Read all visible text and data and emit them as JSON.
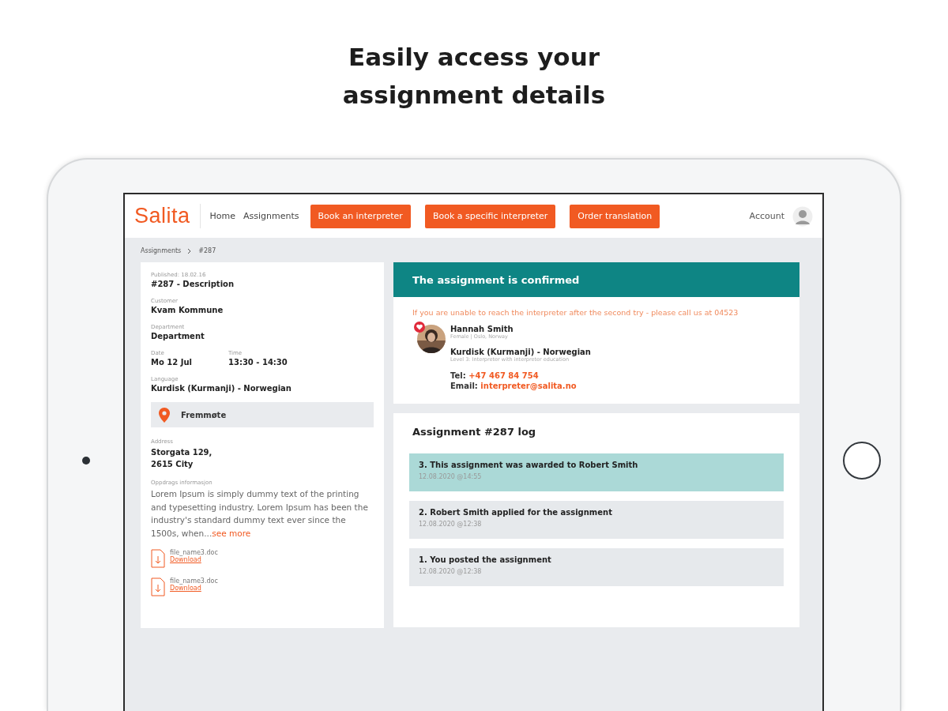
{
  "headline": "Easily access your assignment details",
  "header": {
    "logo": "Salita",
    "nav": [
      {
        "kind": "link",
        "label": "Home"
      },
      {
        "kind": "link",
        "label": "Assignments"
      },
      {
        "kind": "button",
        "label": "Book an interpreter"
      },
      {
        "kind": "button",
        "label": "Book a specific interpreter"
      },
      {
        "kind": "button",
        "label": "Order translation"
      }
    ],
    "account": "Account"
  },
  "breadcrumb": [
    "Assignments",
    "#287"
  ],
  "details": {
    "published": "Published: 18.02.16",
    "title": "#287 - Description",
    "fields": [
      {
        "label": "Customer",
        "value": "Kvam Kommune"
      },
      {
        "label": "Department",
        "value": "Department"
      }
    ],
    "date": {
      "label": "Date",
      "value": "Mo 12 Jul"
    },
    "time": {
      "label": "Time",
      "value": "13:30 - 14:30"
    },
    "language": {
      "label": "Language",
      "value": "Kurdisk (Kurmanji) - Norwegian"
    },
    "location": "Fremmøte",
    "address": {
      "label": "Address",
      "lines": [
        "Storgata 129,",
        "2615 City"
      ]
    },
    "info": {
      "label": "Oppdrags informasjon",
      "text": "Lorem Ipsum is simply dummy text of the printing and typesetting industry. Lorem Ipsum has been the industry's standard dummy text ever since the 1500s, when...",
      "more": "see more"
    },
    "files": [
      {
        "name": "file_name3.doc",
        "action": "Download"
      },
      {
        "name": "file_name3.doc",
        "action": "Download"
      }
    ]
  },
  "confirmation": {
    "title": "The assignment is confirmed",
    "notice": "If you are unable to reach the interpreter after the second try - please call us at 04523",
    "interpreter": {
      "name": "Hannah Smith",
      "meta": "Female | Oslo, Norway",
      "favorite": true,
      "language": "Kurdisk (Kurmanji) - Norwegian",
      "level": "Level 3: Interpreter with interpreter education",
      "tel_label": "Tel:",
      "tel": "+47 467 84 754",
      "email_label": "Email:",
      "email": "interpreter@salita.no"
    }
  },
  "log": {
    "title": "Assignment #287 log",
    "entries": [
      {
        "text": "3. This assignment was awarded to Robert Smith",
        "date": "12.08.2020 @14:55",
        "highlighted": true
      },
      {
        "text": "2. Robert Smith applied for the assignment",
        "date": "12.08.2020 @12:38",
        "highlighted": false
      },
      {
        "text": "1. You posted the assignment",
        "date": "12.08.2020 @12:38",
        "highlighted": false
      }
    ]
  }
}
